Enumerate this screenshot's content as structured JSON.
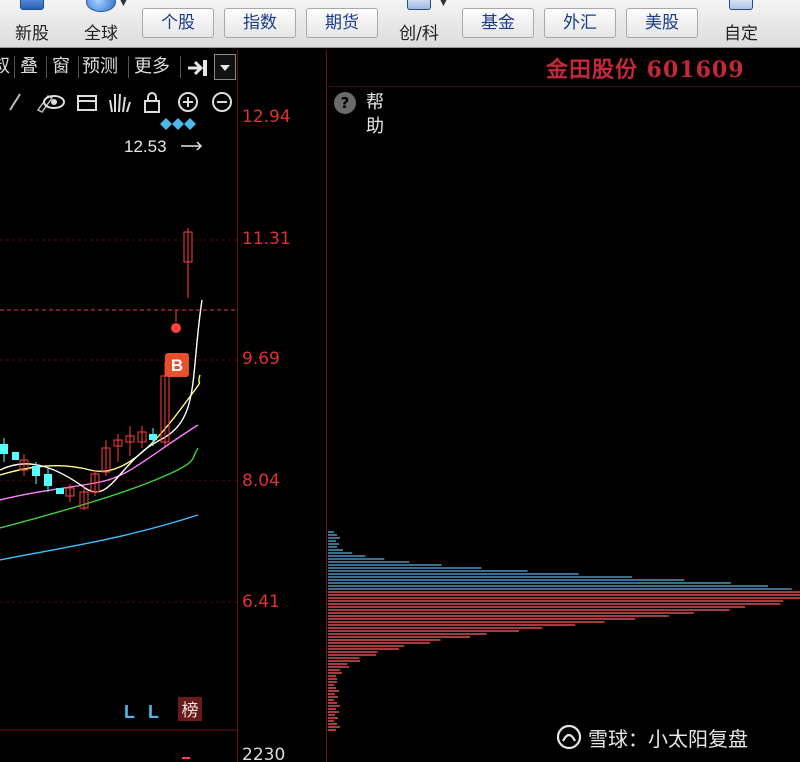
{
  "toolbar": {
    "new_stock": "新股",
    "global": "全球",
    "stock": "个股",
    "index": "指数",
    "futures": "期货",
    "star": "创/科",
    "fund": "基金",
    "forex": "外汇",
    "us_stock": "美股",
    "custom": "自定"
  },
  "chart_tools": {
    "stack": "叠",
    "window": "窗",
    "predict": "预测",
    "more": "更多",
    "partial_left": "叔"
  },
  "stock": {
    "title": "金田股份 601609"
  },
  "help": {
    "icon": "?",
    "label": "帮助"
  },
  "price_axis": {
    "labels": [
      "12.94",
      "11.31",
      "9.69",
      "8.04",
      "6.41"
    ],
    "bottom_label": "2230",
    "high_marker": "12.53"
  },
  "markers": {
    "buy": "B",
    "l1": "L",
    "l2": "L",
    "rank": "榜"
  },
  "watermark": {
    "text": "雪球：小太阳复盘"
  },
  "colors": {
    "up_candle": "#ff4040",
    "down_candle": "#54ffff",
    "ma_white": "#ffffff",
    "ma_yellow": "#ffff80",
    "ma_pink": "#ff80ff",
    "ma_green": "#40d040",
    "ma_cyan": "#40c0ff",
    "profile_blue": "#5bb0e0",
    "profile_red": "#ff6060"
  }
}
